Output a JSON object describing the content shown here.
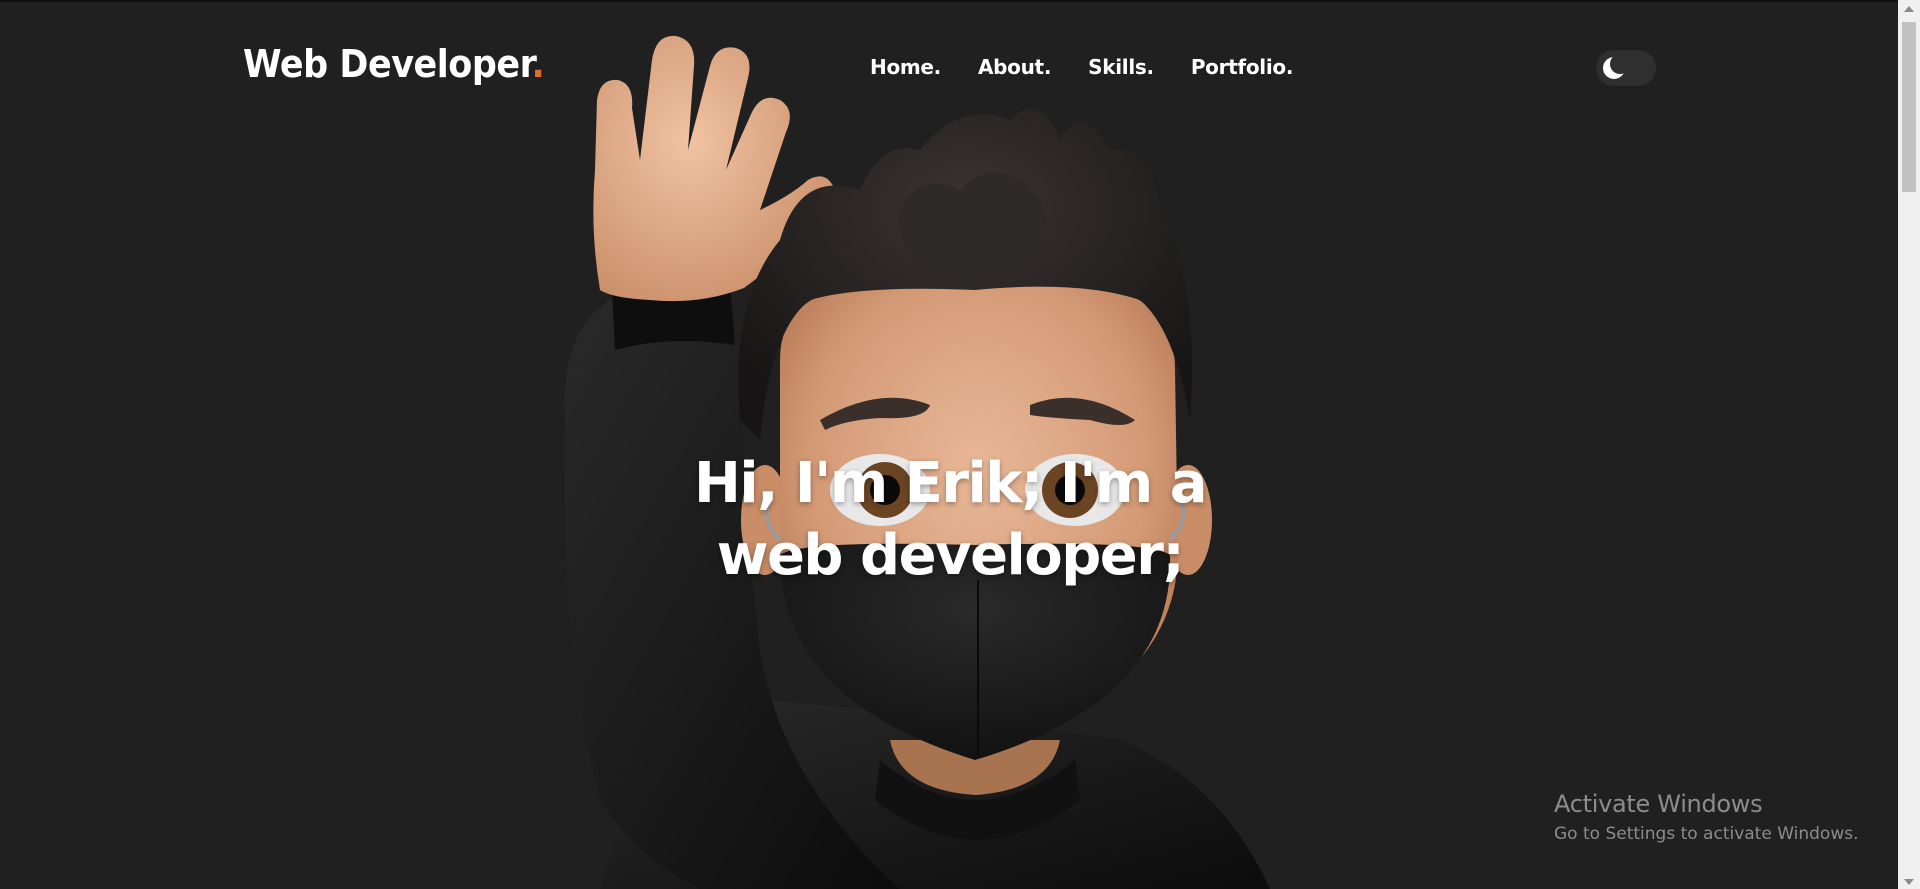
{
  "header": {
    "logo_text": "Web Developer",
    "logo_dot": ".",
    "accent_color": "#e36b2c",
    "nav": [
      {
        "label": "Home."
      },
      {
        "label": "About."
      },
      {
        "label": "Skills."
      },
      {
        "label": "Portfolio."
      }
    ],
    "theme_toggle_icon": "moon-icon"
  },
  "hero": {
    "line1": "Hi, I'm Erik; I'm a",
    "line2": "web developer;",
    "avatar_icon": "memoji-waving-avatar"
  },
  "watermark": {
    "title": "Activate Windows",
    "subtitle": "Go to Settings to activate Windows."
  },
  "colors": {
    "background": "#202020",
    "text": "#ffffff"
  }
}
